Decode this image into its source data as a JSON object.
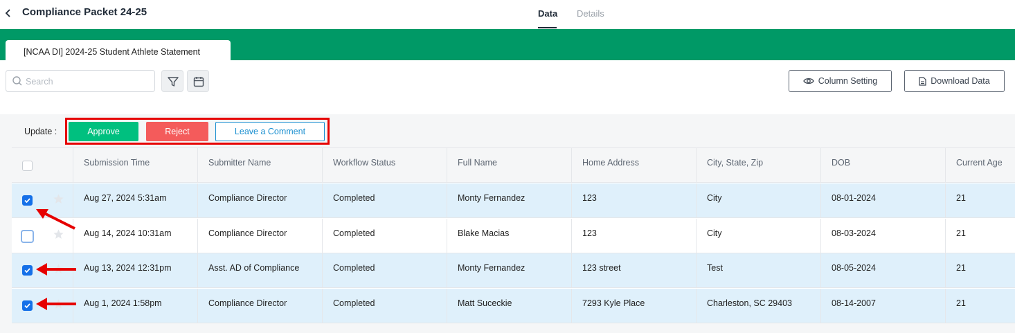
{
  "header": {
    "title": "Compliance Packet 24-25",
    "tabs": [
      {
        "label": "Data",
        "active": true
      },
      {
        "label": "Details",
        "active": false
      }
    ]
  },
  "form_tab": {
    "label": "[NCAA DI] 2024-25 Student Athlete Statement"
  },
  "toolbar": {
    "search_placeholder": "Search",
    "column_setting_label": "Column Setting",
    "download_label": "Download Data"
  },
  "update": {
    "label": "Update :",
    "approve_label": "Approve",
    "reject_label": "Reject",
    "comment_label": "Leave a Comment"
  },
  "table": {
    "columns": [
      "Submission Time",
      "Submitter Name",
      "Workflow Status",
      "Full Name",
      "Home Address",
      "City, State, Zip",
      "DOB",
      "Current Age"
    ],
    "rows": [
      {
        "selected": true,
        "cells": [
          "Aug 27, 2024 5:31am",
          "Compliance Director",
          "Completed",
          "Monty Fernandez",
          "123",
          "City",
          "08-01-2024",
          "21"
        ]
      },
      {
        "selected": false,
        "cells": [
          "Aug 14, 2024 10:31am",
          "Compliance Director",
          "Completed",
          "Blake Macias",
          "123",
          "City",
          "08-03-2024",
          "21"
        ]
      },
      {
        "selected": true,
        "cells": [
          "Aug 13, 2024 12:31pm",
          "Asst. AD of Compliance",
          "Completed",
          "Monty Fernandez",
          "123 street",
          "Test",
          "08-05-2024",
          "21"
        ]
      },
      {
        "selected": true,
        "cells": [
          "Aug 1, 2024 1:58pm",
          "Compliance Director",
          "Completed",
          "Matt Suceckie",
          "7293 Kyle Place",
          "Charleston, SC 29403",
          "08-14-2007",
          "21"
        ]
      }
    ]
  },
  "colors": {
    "brand_green": "#009966",
    "approve": "#00c07f",
    "reject": "#f45b5b",
    "comment": "#1a8fd0",
    "selected_row": "#dff0fb",
    "annotation_red": "#e60000"
  },
  "icons": [
    "chevron-left-icon",
    "search-icon",
    "filter-icon",
    "calendar-icon",
    "eye-icon",
    "download-file-icon",
    "star-icon",
    "arrow-annotation"
  ]
}
